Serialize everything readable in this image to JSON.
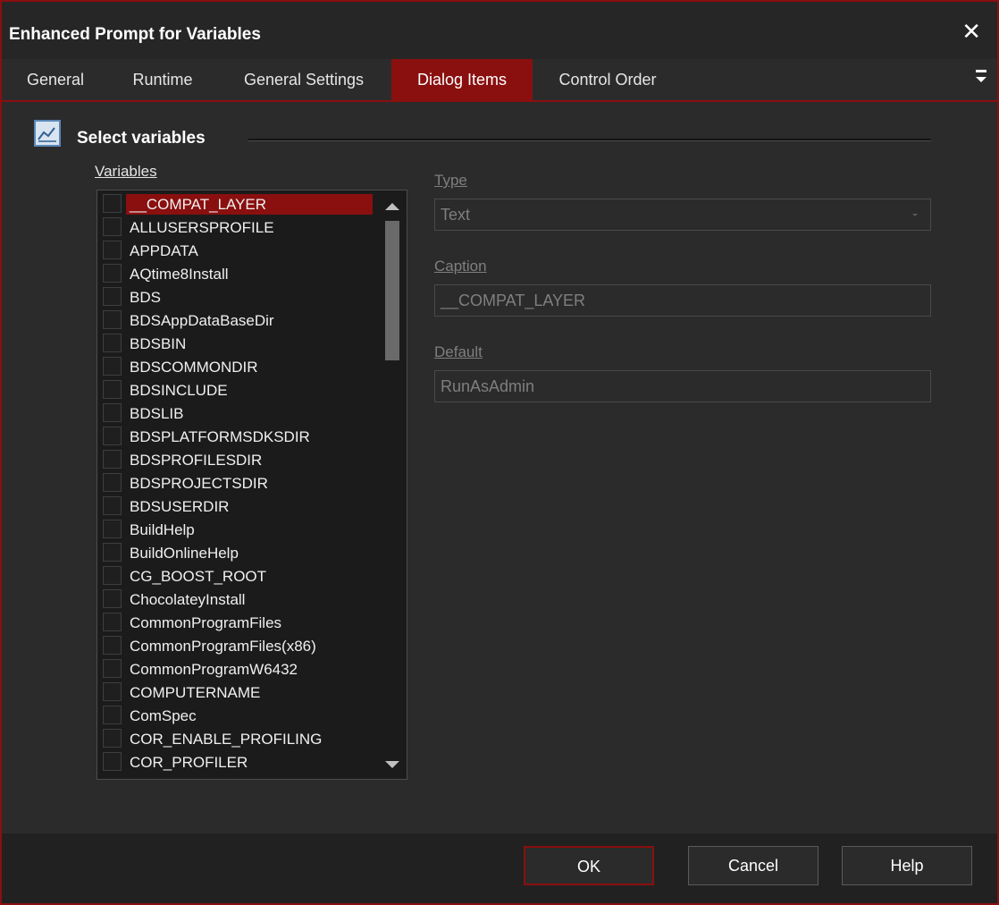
{
  "window": {
    "title": "Enhanced Prompt for Variables"
  },
  "tabs": [
    {
      "label": "General"
    },
    {
      "label": "Runtime"
    },
    {
      "label": "General Settings"
    },
    {
      "label": "Dialog Items"
    },
    {
      "label": "Control Order"
    }
  ],
  "active_tab": "Dialog Items",
  "section": {
    "title": "Select variables"
  },
  "variables": {
    "label": "Variables",
    "selected": "__COMPAT_LAYER",
    "items": [
      "__COMPAT_LAYER",
      "ALLUSERSPROFILE",
      "APPDATA",
      "AQtime8Install",
      "BDS",
      "BDSAppDataBaseDir",
      "BDSBIN",
      "BDSCOMMONDIR",
      "BDSINCLUDE",
      "BDSLIB",
      "BDSPLATFORMSDKSDIR",
      "BDSPROFILESDIR",
      "BDSPROJECTSDIR",
      "BDSUSERDIR",
      "BuildHelp",
      "BuildOnlineHelp",
      "CG_BOOST_ROOT",
      "ChocolateyInstall",
      "CommonProgramFiles",
      "CommonProgramFiles(x86)",
      "CommonProgramW6432",
      "COMPUTERNAME",
      "ComSpec",
      "COR_ENABLE_PROFILING",
      "COR_PROFILER"
    ]
  },
  "type": {
    "label": "Type",
    "value": "Text"
  },
  "caption": {
    "label": "Caption",
    "value": "__COMPAT_LAYER"
  },
  "default": {
    "label": "Default",
    "value": "RunAsAdmin"
  },
  "buttons": {
    "ok": "OK",
    "cancel": "Cancel",
    "help": "Help"
  },
  "colors": {
    "accent": "#8a0f0f",
    "background": "#2b2b2b",
    "list_bg": "#1b1b1b"
  }
}
